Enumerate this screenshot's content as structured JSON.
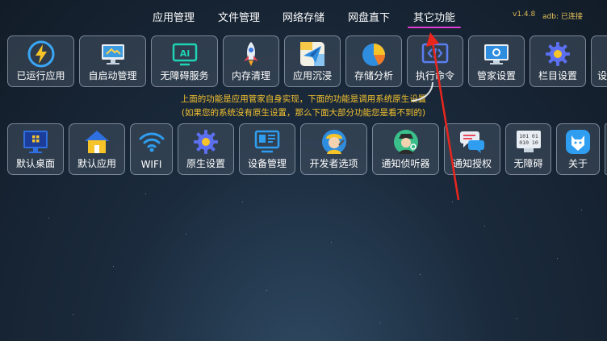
{
  "tabs": [
    {
      "label": "应用管理"
    },
    {
      "label": "文件管理"
    },
    {
      "label": "网络存储"
    },
    {
      "label": "网盘直下"
    },
    {
      "label": "其它功能"
    }
  ],
  "version": "v1.4.8",
  "adb_status": "adb: 已连接",
  "row1": [
    {
      "label": "已运行应用",
      "icon": "lightning-icon"
    },
    {
      "label": "自启动管理",
      "icon": "monitor-icon"
    },
    {
      "label": "无障碍服务",
      "icon": "ai-screen-icon"
    },
    {
      "label": "内存清理",
      "icon": "rocket-icon"
    },
    {
      "label": "应用沉浸",
      "icon": "paper-plane-icon"
    },
    {
      "label": "存储分析",
      "icon": "pie-chart-icon"
    },
    {
      "label": "执行命令",
      "icon": "code-icon"
    },
    {
      "label": "管家设置",
      "icon": "display-gear-icon"
    },
    {
      "label": "栏目设置",
      "icon": "gear-icon"
    },
    {
      "label": "设",
      "icon": "partial-icon"
    }
  ],
  "notes": {
    "line1": "上面的功能是应用管家自身实现，下面的功能是调用系统原生设置",
    "line2": "(如果您的系统没有原生设置，那么下面大部分功能您是看不到的)"
  },
  "row2": [
    {
      "label": "默认桌面",
      "icon": "desktop-grid-icon"
    },
    {
      "label": "默认应用",
      "icon": "home-icon"
    },
    {
      "label": "WIFI",
      "icon": "wifi-icon"
    },
    {
      "label": "原生设置",
      "icon": "gear-icon"
    },
    {
      "label": "设备管理",
      "icon": "device-monitor-icon"
    },
    {
      "label": "开发者选项",
      "icon": "worker-icon"
    },
    {
      "label": "通知侦听器",
      "icon": "detective-icon"
    },
    {
      "label": "通知授权",
      "icon": "chat-bubble-icon"
    },
    {
      "label": "无障碍",
      "icon": "binary-screen-icon"
    },
    {
      "label": "关于",
      "icon": "fox-icon"
    },
    {
      "label": "",
      "icon": "partial-icon"
    }
  ],
  "colors": {
    "accent_underline": "#e23cd8",
    "note": "#f3c12f",
    "version": "#d8b55a",
    "arrow": "#e8261e"
  }
}
